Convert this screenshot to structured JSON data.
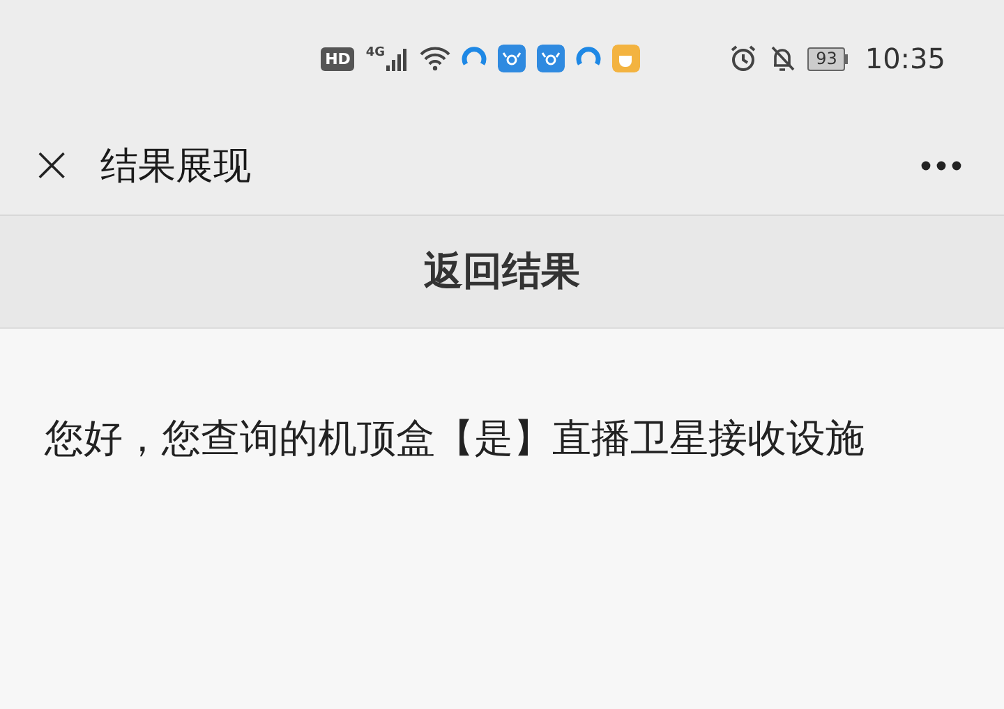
{
  "status_bar": {
    "hd_badge": "HD",
    "network": "4G",
    "battery": "93",
    "time": "10:35"
  },
  "nav_bar": {
    "close": "×",
    "title": "结果展现"
  },
  "section": {
    "title": "返回结果"
  },
  "message": "您好，您查询的机顶盒【是】直播卫星接收设施"
}
